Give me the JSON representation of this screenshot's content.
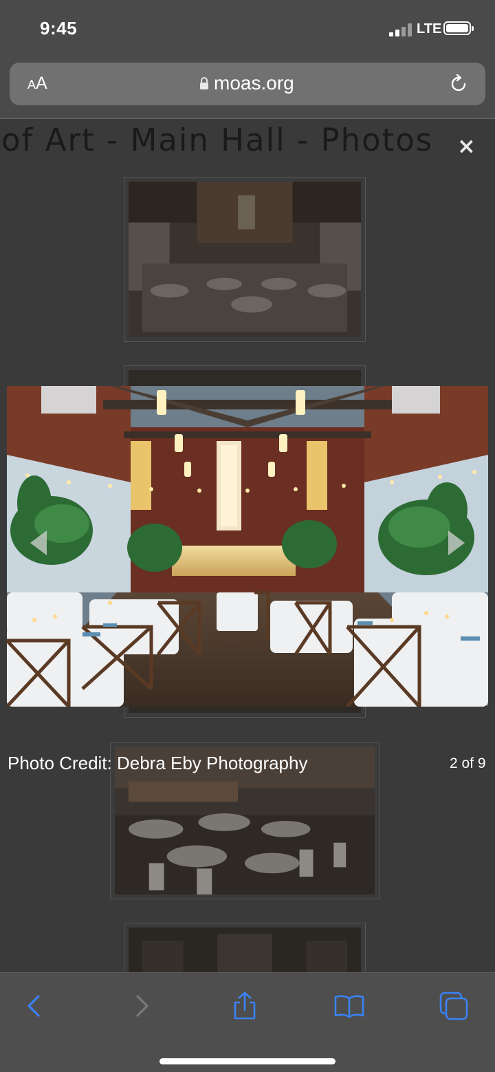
{
  "status_bar": {
    "time": "9:45",
    "network": "LTE"
  },
  "browser": {
    "text_size_label_small": "A",
    "text_size_label_large": "A",
    "url": "moas.org"
  },
  "page": {
    "title": "of Art - Main Hall - Photos",
    "close_label": "×",
    "lightbox": {
      "credit": "Photo Credit: Debra Eby Photography",
      "counter": "2 of 9",
      "current_index": 2,
      "total": 9
    }
  },
  "colors": {
    "accent_blue": "#3b82f6",
    "toolbar_bg": "#4e4e4e",
    "page_bg": "#3a3a3a"
  },
  "toolbar": {
    "icons": [
      "back-chevron-icon",
      "forward-chevron-icon",
      "share-icon",
      "bookmarks-icon",
      "tabs-icon"
    ]
  }
}
